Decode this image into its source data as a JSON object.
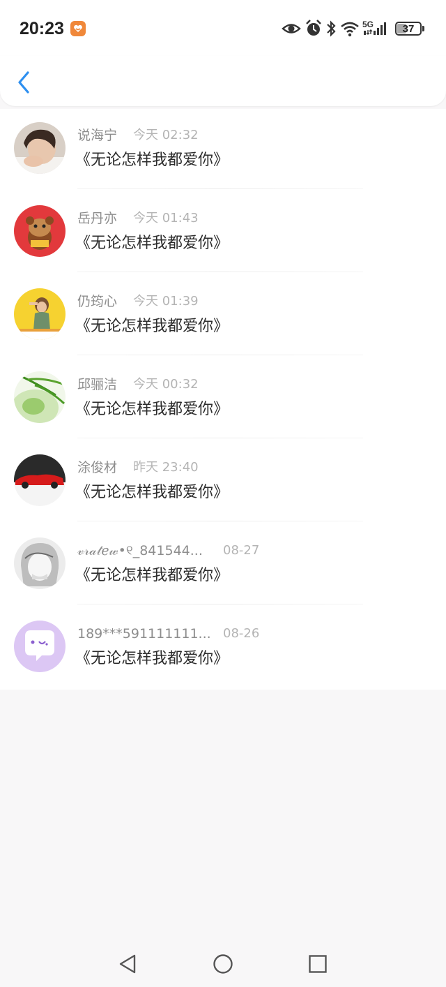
{
  "status_bar": {
    "time": "20:23",
    "network": "5G",
    "battery": "37",
    "icons": [
      "app-badge-icon",
      "eye-icon",
      "alarm-icon",
      "bluetooth-icon",
      "wifi-icon",
      "signal-icon",
      "battery-icon"
    ]
  },
  "header": {
    "back_icon": "chevron-left-icon",
    "accent_color": "#2d8ff0"
  },
  "conversations": [
    {
      "name": "说海宁",
      "time": "今天 02:32",
      "message": "《无论怎样我都爱你》",
      "avatar": "boy-photo"
    },
    {
      "name": "岳丹亦",
      "time": "今天 01:43",
      "message": "《无论怎样我都爱你》",
      "avatar": "cartoon-bear"
    },
    {
      "name": "仍筠心",
      "time": "今天 01:39",
      "message": "《无论怎样我都爱你》",
      "avatar": "yellow-photo"
    },
    {
      "name": "邱骊洁",
      "time": "今天 00:32",
      "message": "《无论怎样我都爱你》",
      "avatar": "bamboo"
    },
    {
      "name": "涂俊材",
      "time": "昨天 23:40",
      "message": "《无论怎样我都爱你》",
      "avatar": "red-car"
    },
    {
      "name": "𝓋𝓇𝒶𝓉ℯ𝓌•୧_841544...",
      "time": "08-27",
      "message": "《无论怎样我都爱你》",
      "avatar": "anime-sketch"
    },
    {
      "name": "189***591111111...",
      "time": "08-26",
      "message": "《无论怎样我都爱你》",
      "avatar": "chat-bubble"
    }
  ],
  "nav_bar": {
    "icons": [
      "back-triangle-icon",
      "home-circle-icon",
      "recents-square-icon"
    ]
  }
}
